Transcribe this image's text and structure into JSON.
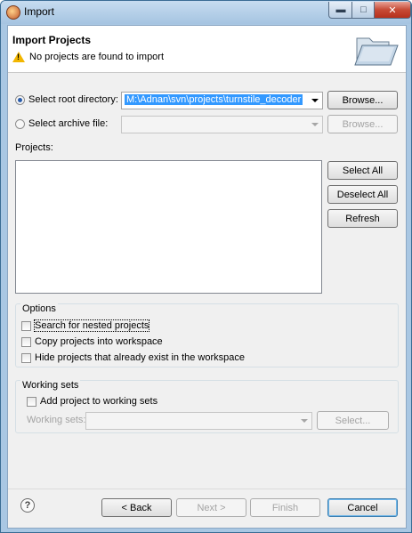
{
  "window": {
    "title": "Import"
  },
  "header": {
    "title": "Import Projects",
    "message": "No projects are found to import"
  },
  "source": {
    "root_directory_label": "Select root directory:",
    "root_directory_value": "M:\\Adnan\\svn\\projects\\turnstile_decoder",
    "archive_file_label": "Select archive file:",
    "archive_file_value": "",
    "browse_label": "Browse..."
  },
  "projects": {
    "label": "Projects:",
    "items": [],
    "select_all_label": "Select All",
    "deselect_all_label": "Deselect All",
    "refresh_label": "Refresh"
  },
  "options": {
    "title": "Options",
    "search_nested": {
      "label": "Search for nested projects",
      "checked": false
    },
    "copy_into_workspace": {
      "label": "Copy projects into workspace",
      "checked": false
    },
    "hide_existing": {
      "label": "Hide projects that already exist in the workspace",
      "checked": false
    }
  },
  "working_sets": {
    "title": "Working sets",
    "add_to_working_sets": {
      "label": "Add project to working sets",
      "checked": false
    },
    "sets_label": "Working sets:",
    "sets_value": "",
    "select_label": "Select..."
  },
  "footer": {
    "back_label": "< Back",
    "next_label": "Next >",
    "finish_label": "Finish",
    "cancel_label": "Cancel"
  },
  "colors": {
    "selection": "#3399ff",
    "disabled_text": "#a3a3a3",
    "warning": "#f2b600"
  }
}
